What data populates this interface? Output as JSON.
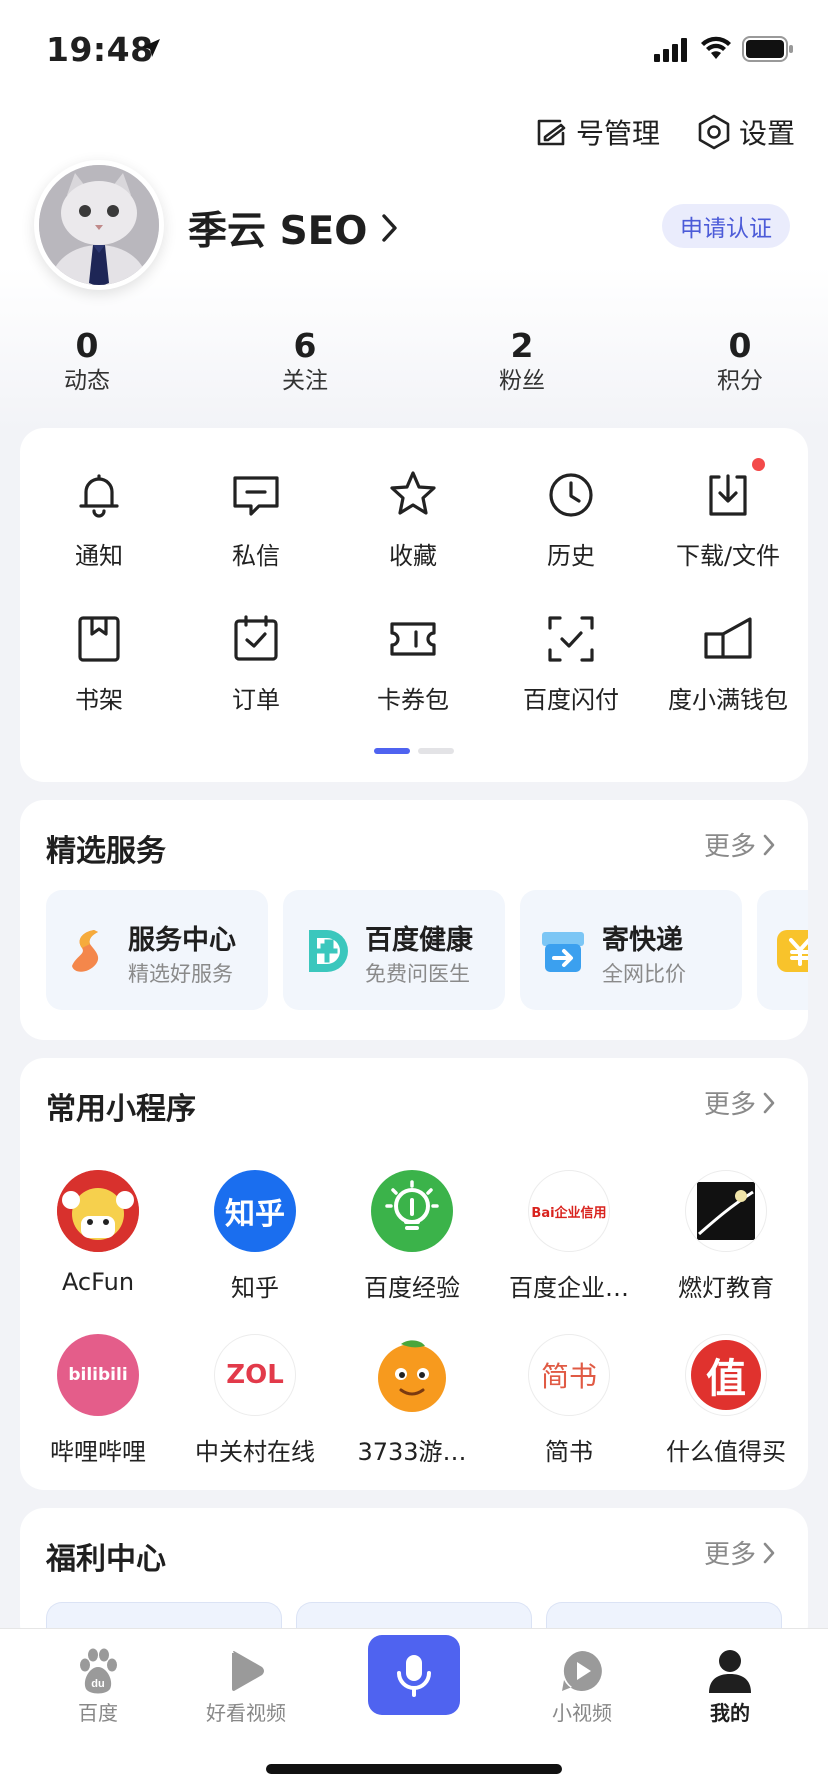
{
  "status_bar": {
    "time": "19:48"
  },
  "header": {
    "account_manage": "号管理",
    "settings": "设置"
  },
  "profile": {
    "username": "季云 SEO",
    "verify_label": "申请认证"
  },
  "stats": [
    {
      "value": "0",
      "label": "动态"
    },
    {
      "value": "6",
      "label": "关注"
    },
    {
      "value": "2",
      "label": "粉丝"
    },
    {
      "value": "0",
      "label": "积分"
    }
  ],
  "quick_grid": [
    {
      "label": "通知",
      "icon": "bell-icon"
    },
    {
      "label": "私信",
      "icon": "message-icon"
    },
    {
      "label": "收藏",
      "icon": "star-icon"
    },
    {
      "label": "历史",
      "icon": "clock-icon"
    },
    {
      "label": "下载/文件",
      "icon": "download-icon"
    },
    {
      "label": "书架",
      "icon": "bookshelf-icon"
    },
    {
      "label": "订单",
      "icon": "order-icon"
    },
    {
      "label": "卡券包",
      "icon": "coupon-icon"
    },
    {
      "label": "百度闪付",
      "icon": "scan-pay-icon"
    },
    {
      "label": "度小满钱包",
      "icon": "wallet-icon"
    }
  ],
  "services": {
    "title": "精选服务",
    "more": "更多",
    "items": [
      {
        "title": "服务中心",
        "subtitle": "精选好服务",
        "icon": "service-center-icon"
      },
      {
        "title": "百度健康",
        "subtitle": "免费问医生",
        "icon": "health-icon"
      },
      {
        "title": "寄快递",
        "subtitle": "全网比价",
        "icon": "express-icon"
      }
    ]
  },
  "mini_programs": {
    "title": "常用小程序",
    "more": "更多",
    "items": [
      {
        "label": "AcFun",
        "icon": "acfun-icon"
      },
      {
        "label": "知乎",
        "icon": "zhihu-icon",
        "icon_text": "知乎"
      },
      {
        "label": "百度经验",
        "icon": "baidu-jingyan-icon"
      },
      {
        "label": "百度企业…",
        "icon": "baidu-enterprise-icon",
        "icon_text": "Bai企业信用"
      },
      {
        "label": "燃灯教育",
        "icon": "randeng-icon"
      },
      {
        "label": "哔哩哔哩",
        "icon": "bilibili-icon",
        "icon_text": "bilibili"
      },
      {
        "label": "中关村在线",
        "icon": "zol-icon",
        "icon_text": "ZOL"
      },
      {
        "label": "3733游…",
        "icon": "game3733-icon"
      },
      {
        "label": "简书",
        "icon": "jianshu-icon",
        "icon_text": "简书"
      },
      {
        "label": "什么值得买",
        "icon": "smzdm-icon",
        "icon_text": "值"
      }
    ]
  },
  "benefits": {
    "title": "福利中心",
    "more": "更多"
  },
  "tab_bar": [
    {
      "label": "百度",
      "icon": "baidu-paw-icon"
    },
    {
      "label": "好看视频",
      "icon": "play-icon"
    },
    {
      "label": "",
      "icon": "mic-icon"
    },
    {
      "label": "小视频",
      "icon": "small-video-icon"
    },
    {
      "label": "我的",
      "icon": "profile-icon"
    }
  ],
  "colors": {
    "accent": "#4f63f0",
    "badge_red": "#f34a4a",
    "verify_text": "#4c5bd8"
  }
}
